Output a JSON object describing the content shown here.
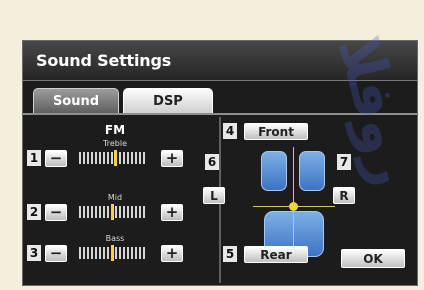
{
  "window": {
    "title": "Sound Settings"
  },
  "tabs": [
    {
      "label": "Sound",
      "active": true
    },
    {
      "label": "DSP",
      "active": false
    }
  ],
  "left_panel": {
    "source": "FM",
    "sliders": [
      {
        "index": "1",
        "label": "Treble",
        "minus": "−",
        "plus": "+",
        "level": 0.55
      },
      {
        "index": "2",
        "label": "Mid",
        "minus": "−",
        "plus": "+",
        "level": 0.5
      },
      {
        "index": "3",
        "label": "Bass",
        "minus": "−",
        "plus": "+",
        "level": 0.5
      }
    ]
  },
  "right_panel": {
    "front": {
      "index": "4",
      "label": "Front"
    },
    "rear": {
      "index": "5",
      "label": "Rear"
    },
    "left": {
      "index": "6",
      "label": "L"
    },
    "right": {
      "index": "7",
      "label": "R"
    },
    "ok": "OK"
  },
  "colors": {
    "accent": "#f2d43e",
    "seat": "#4d88d4",
    "panel_bg": "#1c1c1c",
    "page_bg": "#f3efdc"
  },
  "icons": [
    "minus-icon",
    "plus-icon",
    "seat-icon"
  ]
}
